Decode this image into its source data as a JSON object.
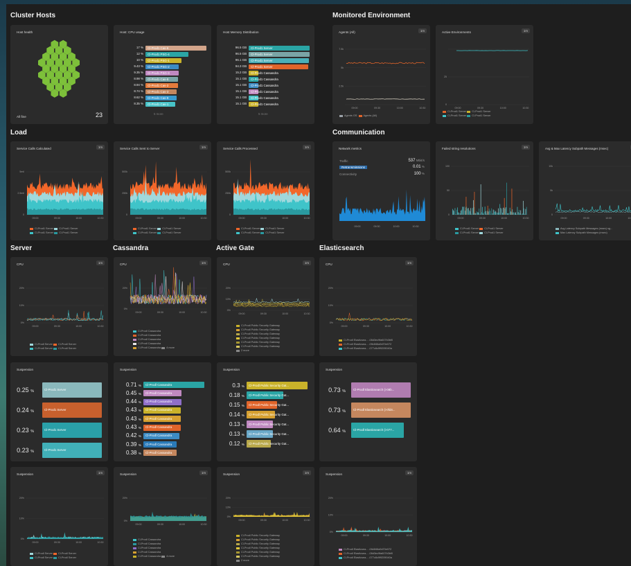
{
  "sections": {
    "cluster_hosts": "Cluster Hosts",
    "monitored_environment": "Monitored Environment",
    "load": "Load",
    "communication": "Communication",
    "server": "Server",
    "cassandra": "Cassandra",
    "active_gate": "Active Gate",
    "elasticsearch": "Elasticsearch"
  },
  "host_health": {
    "title": "Host health",
    "status": "All fine",
    "count": "23"
  },
  "cpu_usage": {
    "title": "Host: CPU usage",
    "more": "5 more",
    "rows": [
      {
        "value": "17",
        "unit": "%",
        "label": "Cl-Prod1 Cas-6",
        "pct": 100,
        "color": "#d3a58a"
      },
      {
        "value": "12",
        "unit": "%",
        "label": "Cl-Prod1 PSG-4",
        "pct": 71,
        "color": "#2aa5a5"
      },
      {
        "value": "10",
        "unit": "%",
        "label": "Cl-Prod1 PSG-1",
        "pct": 59,
        "color": "#c9b22a"
      },
      {
        "value": "9.43",
        "unit": "%",
        "label": "Cl-Prod1 PSG-2",
        "pct": 55,
        "color": "#3c8bc4"
      },
      {
        "value": "9.35",
        "unit": "%",
        "label": "Cl-Prod1 PSG-3",
        "pct": 55,
        "color": "#c089c0"
      },
      {
        "value": "8.98",
        "unit": "%",
        "label": "Cl-Prod1 Cas-8",
        "pct": 53,
        "color": "#7aa5a6"
      },
      {
        "value": "8.94",
        "unit": "%",
        "label": "Cl-Prod1 Cas-2",
        "pct": 53,
        "color": "#e47b3c"
      },
      {
        "value": "8.74",
        "unit": "%",
        "label": "Cl-Prod1 Cas-3",
        "pct": 51,
        "color": "#c5875e"
      },
      {
        "value": "8.62",
        "unit": "%",
        "label": "Cl-Prod1 Cas-9",
        "pct": 51,
        "color": "#3a9bcf"
      },
      {
        "value": "8.35",
        "unit": "%",
        "label": "Cl-Prod1 Cas-1",
        "pct": 49,
        "color": "#47c2c7"
      }
    ]
  },
  "memory": {
    "title": "Host Memory Distribution",
    "more": "5 more",
    "rows": [
      {
        "value": "96.5",
        "unit": "GB",
        "label": "Cl-Prod1 Server",
        "pct": 100,
        "color": "#2aa5a5"
      },
      {
        "value": "96.5",
        "unit": "GB",
        "label": "Cl-Prod1 Server",
        "pct": 100,
        "color": "#7aa5a6"
      },
      {
        "value": "96.1",
        "unit": "GB",
        "label": "Cl-Prod1 Server",
        "pct": 99,
        "color": "#4aafb8"
      },
      {
        "value": "94.3",
        "unit": "GB",
        "label": "Cl-Prod1 Server",
        "pct": 98,
        "color": "#e0642a"
      },
      {
        "value": "15.2",
        "unit": "GB",
        "label": "Cl-Prod1 Cassandra",
        "pct": 16,
        "color": "#c9b22a"
      },
      {
        "value": "15.1",
        "unit": "GB",
        "label": "Cl-Prod1 Cassandra",
        "pct": 16,
        "color": "#2aa5a5"
      },
      {
        "value": "15.1",
        "unit": "GB",
        "label": "Cl-Prod1 Cassandra",
        "pct": 16,
        "color": "#3c8bc4"
      },
      {
        "value": "15.1",
        "unit": "GB",
        "label": "Cl-Prod1 Cassandra",
        "pct": 16,
        "color": "#c089c0"
      },
      {
        "value": "15.1",
        "unit": "GB",
        "label": "Cl-Prod1 Cassandra",
        "pct": 16,
        "color": "#47c2c7"
      },
      {
        "value": "15.1",
        "unit": "GB",
        "label": "Cl-Prod1 Cassandra",
        "pct": 16,
        "color": "#c9b22a"
      }
    ]
  },
  "agents": {
    "title": "Agents (All)",
    "badge": "1m",
    "yticks": [
      "2.5k",
      "5k",
      "7.5k"
    ],
    "xticks": [
      "09:00",
      "09:30",
      "10:00",
      "10:30"
    ],
    "legend": [
      "Agents OS",
      "Agents (All)"
    ]
  },
  "active_env": {
    "title": "Active Environments",
    "badge": "1m",
    "yticks": [
      "0",
      "25"
    ],
    "xticks": [
      "09:00",
      "09:30",
      "10:00",
      "10:30"
    ],
    "legend": [
      "Cl-Prod1 Server",
      "Cl-Prod1 Server",
      "Cl-Prod1 Server",
      "Cl-Prod1 Server"
    ]
  },
  "load_tiles": [
    {
      "title": "Service Calls Calculated",
      "badge": "1m",
      "yticks": [
        "0",
        "2.5mil",
        "5mil"
      ],
      "xticks": [
        "09:00",
        "09:30",
        "10:00",
        "10:30"
      ],
      "legend": [
        "Cl-Prod1 Server",
        "Cl-Prod1 Server",
        "Cl-Prod1 Server",
        "Cl-Prod1 Server"
      ]
    },
    {
      "title": "Service Calls Sent to Server",
      "badge": "1m",
      "yticks": [
        "0",
        "250k",
        "500k"
      ],
      "xticks": [
        "09:00",
        "09:30",
        "10:00",
        "10:30"
      ],
      "legend": [
        "Cl-Prod1 Server",
        "Cl-Prod1 Server",
        "Cl-Prod1 Server",
        "Cl-Prod1 Server"
      ]
    },
    {
      "title": "Service Calls Processed",
      "badge": "1m",
      "yticks": [
        "0",
        "250k",
        "500k"
      ],
      "xticks": [
        "09:00",
        "09:30",
        "10:00",
        "10:30"
      ],
      "legend": [
        "Cl-Prod1 Server",
        "Cl-Prod1 Server",
        "Cl-Prod1 Server",
        "Cl-Prod1 Server"
      ]
    }
  ],
  "network": {
    "title": "Network metrics",
    "traffic_label": "Traffic",
    "traffic_value": "537",
    "traffic_unit": "Mbit/s",
    "retrans_label": "Retransmissions",
    "retrans_value": "0.01",
    "retrans_unit": "%",
    "conn_label": "Connectivity",
    "conn_value": "100",
    "conn_unit": "%",
    "xticks": [
      "09:00",
      "09:30",
      "10:00",
      "10:30"
    ]
  },
  "failed": {
    "title": "Failed string resolutions",
    "badge": "1m",
    "yticks": [
      "0",
      "50",
      "100"
    ],
    "xticks": [
      "09:00",
      "09:30",
      "10:00",
      "10:30"
    ],
    "legend": [
      "Cl-Prod1 Server",
      "Cl-Prod1 Server",
      "Cl-Prod1 Server",
      "Cl-Prod1 Server"
    ]
  },
  "latency": {
    "title": "Avg & Max Latency Subpath Messages (msec)",
    "badge": "1m",
    "yticks": [
      "0",
      "5k",
      "10k"
    ],
    "xticks": [
      "09:00",
      "09:30",
      "10:00",
      "10:30"
    ],
    "legend": [
      "Avg Latency Subpath Messages (msec) sg...",
      "Max Latency Subpath Messages (msec)"
    ]
  },
  "cpu_tiles": [
    {
      "title": "CPU",
      "badge": "1m",
      "yticks": [
        "0%",
        "10%",
        "20%"
      ],
      "xticks": [
        "09:00",
        "09:30",
        "10:00",
        "10:30"
      ],
      "legend": [
        "Cl-Prodl Server",
        "Cl-Prodl Server",
        "Cl-Prodl Server",
        "Cl-Prodl Server"
      ]
    },
    {
      "title": "CPU",
      "badge": "1m",
      "yticks": [
        "0%",
        "20%"
      ],
      "xticks": [
        "09:00",
        "09:30",
        "10:00",
        "10:30"
      ],
      "legend": [
        "Cl-Prodl Cassandra",
        "Cl-Prodl Cassandra",
        "Cl-Prodl Cassandra",
        "Cl-Prodl Cassandra",
        "Cl-Prodl Cassandra"
      ],
      "more": "4 more"
    },
    {
      "title": "CPU",
      "badge": "1m",
      "yticks": [
        "0%",
        "10%",
        "20%"
      ],
      "xticks": [
        "09:00",
        "09:30",
        "10:00",
        "10:30"
      ],
      "legend": [
        "Cl-Prodl Public Security Gateway",
        "Cl-Prodl Public Security Gateway",
        "Cl-Prodl Public Security Gateway",
        "Cl-Prodl Public Security Gateway",
        "Cl-Prodl Public Security Gateway",
        "Cl-Prodl Public Security Gateway"
      ],
      "more": "2 more"
    },
    {
      "title": "CPU",
      "badge": "1m",
      "yticks": [
        "0%",
        "10%",
        "20%"
      ],
      "xticks": [
        "09:00",
        "09:30",
        "10:00",
        "10:30"
      ],
      "legend": [
        "Cl-Prodl Elasticsea... -08d3ec9fa607b3bf0",
        "Cl-Prodl Elasticsea... -0fb4f46a9d70e072",
        "Cl-Prodl Elasticsea... -077c8c9f9209040a"
      ]
    }
  ],
  "susp_server": {
    "title": "Suspension",
    "rows": [
      {
        "value": "0.25",
        "unit": "%",
        "label": "Cl-Prod1 Server",
        "color": "#8ab8bc"
      },
      {
        "value": "0.24",
        "unit": "%",
        "label": "Cl-Prod1 Server",
        "color": "#c8602d"
      },
      {
        "value": "0.23",
        "unit": "%",
        "label": "Cl-Prod1 Server",
        "color": "#2aa0a8"
      },
      {
        "value": "0.23",
        "unit": "%",
        "label": "Cl-Prod1 Server",
        "color": "#41b0b8"
      }
    ]
  },
  "susp_cassandra": {
    "title": "Suspension",
    "rows": [
      {
        "value": "0.71",
        "unit": "%",
        "label": "Cl-Prodl Cassandra",
        "pct": 100,
        "color": "#2aa5a5"
      },
      {
        "value": "0.45",
        "unit": "%",
        "label": "Cl-Prodl Cassandra",
        "pct": 63,
        "color": "#c089c0"
      },
      {
        "value": "0.44",
        "unit": "%",
        "label": "Cl-Prodl Cassandra",
        "pct": 62,
        "color": "#8f6fc9"
      },
      {
        "value": "0.43",
        "unit": "%",
        "label": "Cl-Prodl Cassandra",
        "pct": 61,
        "color": "#c9b22a"
      },
      {
        "value": "0.43",
        "unit": "%",
        "label": "Cl-Prodl Cassandra",
        "pct": 61,
        "color": "#d6a030"
      },
      {
        "value": "0.43",
        "unit": "%",
        "label": "Cl-Prodl Cassandra",
        "pct": 61,
        "color": "#e0642a"
      },
      {
        "value": "0.42",
        "unit": "%",
        "label": "Cl-Prodl Cassandra",
        "pct": 59,
        "color": "#3c8bc4"
      },
      {
        "value": "0.39",
        "unit": "%",
        "label": "Cl-Prodl Cassandra",
        "pct": 55,
        "color": "#2a7ab8"
      },
      {
        "value": "0.38",
        "unit": "%",
        "label": "Cl-Prodl Cassandra",
        "pct": 54,
        "color": "#c5875e"
      }
    ]
  },
  "susp_gateway": {
    "title": "Suspension",
    "rows": [
      {
        "value": "0.3",
        "unit": "%",
        "label": "Cl-Prodl Public Security Gat...",
        "pct": 100,
        "color": "#c9b22a"
      },
      {
        "value": "0.18",
        "unit": "%",
        "label": "Cl-Prodl Public Security Gat...",
        "pct": 60,
        "color": "#2aa5a5"
      },
      {
        "value": "0.15",
        "unit": "%",
        "label": "Cl-Prodl Public Security Gat...",
        "pct": 50,
        "color": "#e0642a"
      },
      {
        "value": "0.14",
        "unit": "%",
        "label": "Cl-Prodl Public Security Gat...",
        "pct": 47,
        "color": "#d6a030"
      },
      {
        "value": "0.13",
        "unit": "%",
        "label": "Cl-Prodl Public Security Gat...",
        "pct": 43,
        "color": "#c089c0"
      },
      {
        "value": "0.13",
        "unit": "%",
        "label": "Cl-Prodl Public Security Gat...",
        "pct": 43,
        "color": "#6aa8c8"
      },
      {
        "value": "0.12",
        "unit": "%",
        "label": "Cl-Prodl Public Security Gat...",
        "pct": 40,
        "color": "#b8a84a"
      }
    ]
  },
  "susp_elastic": {
    "title": "Suspension",
    "rows": [
      {
        "value": "0.73",
        "unit": "%",
        "label": "Cl-Prodl Elasticsearch (i-08b...",
        "pct": 100,
        "color": "#b07cb0"
      },
      {
        "value": "0.73",
        "unit": "%",
        "label": "Cl-Prodl Elasticsearch (i-0fd4...",
        "pct": 100,
        "color": "#c5875e"
      },
      {
        "value": "0.64",
        "unit": "%",
        "label": "Cl-Prodl Elasticsearch (i-077...",
        "pct": 88,
        "color": "#2aa5a5"
      }
    ]
  },
  "susp_chart_tiles": [
    {
      "title": "Suspension",
      "badge": "1m",
      "yticks": [
        "0%",
        "10%",
        "20%"
      ],
      "xticks": [
        "09:00",
        "09:30",
        "10:00",
        "10:30"
      ],
      "legend": [
        "Cl-Prodl Server",
        "Cl-Prodl Server",
        "Cl-Prodl Server",
        "Cl-Prodl Server"
      ]
    },
    {
      "title": "Suspension",
      "badge": "1m",
      "yticks": [
        "0%",
        "20%"
      ],
      "xticks": [
        "09:00",
        "09:30",
        "10:00",
        "10:30"
      ],
      "legend": [
        "Cl-Prodl Cassandra",
        "Cl-Prodl Cassandra",
        "Cl-Prodl Cassandra",
        "Cl-Prodl Cassandra",
        "Cl-Prodl Cassandra"
      ],
      "more": "4 more"
    },
    {
      "title": "Suspension",
      "badge": "1m",
      "yticks": [
        "0%",
        "10%",
        "20%"
      ],
      "xticks": [
        "09:00",
        "09:30",
        "10:00",
        "10:30"
      ],
      "legend": [
        "Cl-Prodl Public Security Gateway",
        "Cl-Prodl Public Security Gateway",
        "Cl-Prodl Public Security Gateway",
        "Cl-Prodl Public Security Gateway",
        "Cl-Prodl Public Security Gateway",
        "Cl-Prodl Public Security Gateway"
      ],
      "more": "2 more"
    },
    {
      "title": "Suspension",
      "badge": "1m",
      "yticks": [
        "0%",
        "10%",
        "20%"
      ],
      "xticks": [
        "09:00",
        "09:30",
        "10:00",
        "10:30"
      ],
      "legend": [
        "Cl-Prodl Elasticsea... -0fd4f46a9d70e072",
        "Cl-Prodl Elasticsea... -08d3ec9fa607b3bf0",
        "Cl-Prodl Elasticsea... -077c8c9f9209040a"
      ]
    }
  ],
  "colors": {
    "teal": "#3fc4c9",
    "orange": "#f2672a",
    "hexgreen": "#7dc03a",
    "blue": "#1f8ad6",
    "yellow": "#d6c22a"
  }
}
